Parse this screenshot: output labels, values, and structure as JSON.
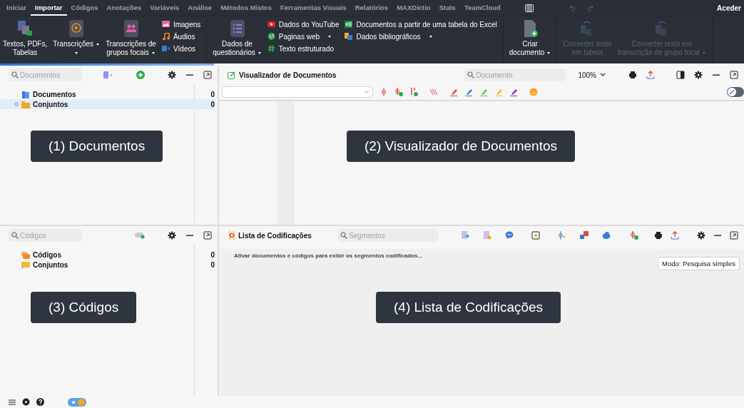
{
  "menu": [
    {
      "label": "Iniciar",
      "selected": false
    },
    {
      "label": "Importar",
      "selected": true
    },
    {
      "label": "Códigos",
      "selected": false
    },
    {
      "label": "Anotações",
      "selected": false
    },
    {
      "label": "Variáveis",
      "selected": false
    },
    {
      "label": "Análise",
      "selected": false
    },
    {
      "label": "Métodos Mistos",
      "selected": false
    },
    {
      "label": "Ferramentas Visuais",
      "selected": false
    },
    {
      "label": "Relatórios",
      "selected": false
    },
    {
      "label": "MAXDictio",
      "selected": false
    },
    {
      "label": "Stats",
      "selected": false
    },
    {
      "label": "TeamCloud",
      "selected": false
    }
  ],
  "account": "Aceder",
  "ribbon": [
    {
      "kind": "large",
      "lines": [
        "Textos, PDFs,",
        "Tabelas"
      ],
      "dropdown": false,
      "disabled": false
    },
    {
      "kind": "large",
      "lines": [
        "Transcrições"
      ],
      "dropdown": true,
      "disabled": false
    },
    {
      "kind": "large",
      "lines": [
        "Transcrições de",
        "grupos focais"
      ],
      "dropdown": true,
      "disabled": false
    },
    {
      "kind": "stack",
      "items": [
        {
          "label": "Imagens",
          "dropdown": false
        },
        {
          "label": "Áudios",
          "dropdown": false
        },
        {
          "label": "Vídeos",
          "dropdown": false
        }
      ]
    },
    {
      "kind": "divider"
    },
    {
      "kind": "large",
      "lines": [
        "Dados de",
        "questionários"
      ],
      "dropdown": true,
      "disabled": false
    },
    {
      "kind": "stack",
      "items": [
        {
          "label": "Dados do YouTube",
          "dropdown": false
        },
        {
          "label": "Paginas web",
          "dropdown": true
        },
        {
          "label": "Texto estruturado",
          "dropdown": false
        }
      ]
    },
    {
      "kind": "stack",
      "items": [
        {
          "label": "Documentos a partir de uma tabela do Excel",
          "dropdown": false
        },
        {
          "label": "Dados bibliográficos",
          "dropdown": true
        }
      ]
    },
    {
      "kind": "divider"
    },
    {
      "kind": "large",
      "lines": [
        "Criar",
        "documento"
      ],
      "dropdown": true,
      "disabled": false
    },
    {
      "kind": "divider"
    },
    {
      "kind": "large",
      "lines": [
        "Converter texto",
        "em tabela"
      ],
      "dropdown": false,
      "disabled": true
    },
    {
      "kind": "large",
      "lines": [
        "Converter texto em",
        "transcrição de grupo focal"
      ],
      "dropdown": true,
      "disabled": true
    },
    {
      "kind": "divider"
    }
  ],
  "documents_panel": {
    "search_placeholder": "Documentos",
    "tree": [
      {
        "label": "Documentos",
        "count": "0",
        "selected": false
      },
      {
        "label": "Conjuntos",
        "count": "0",
        "selected": true,
        "expanded": false
      }
    ],
    "callout": "(1) Documentos"
  },
  "viewer": {
    "title": "Visualizador de Documentos",
    "search_placeholder": "Documento",
    "zoom": "100%",
    "edit_mode": false,
    "callout": "(2) Visualizador de Documentos"
  },
  "codes_panel": {
    "search_placeholder": "Códigos",
    "tree": [
      {
        "label": "Códigos",
        "count": "0",
        "selected": false
      },
      {
        "label": "Conjuntos",
        "count": "0",
        "selected": false
      }
    ],
    "callout": "(3) Códigos"
  },
  "coded_segments": {
    "title": "Lista de Codificações",
    "search_placeholder": "Segmentos",
    "message": "Ativar documentos e códigos para exibir os segmentos codificados...",
    "mode_button": "Modo: Pesquisa simples",
    "callout": "(4) Lista de Codificações"
  }
}
